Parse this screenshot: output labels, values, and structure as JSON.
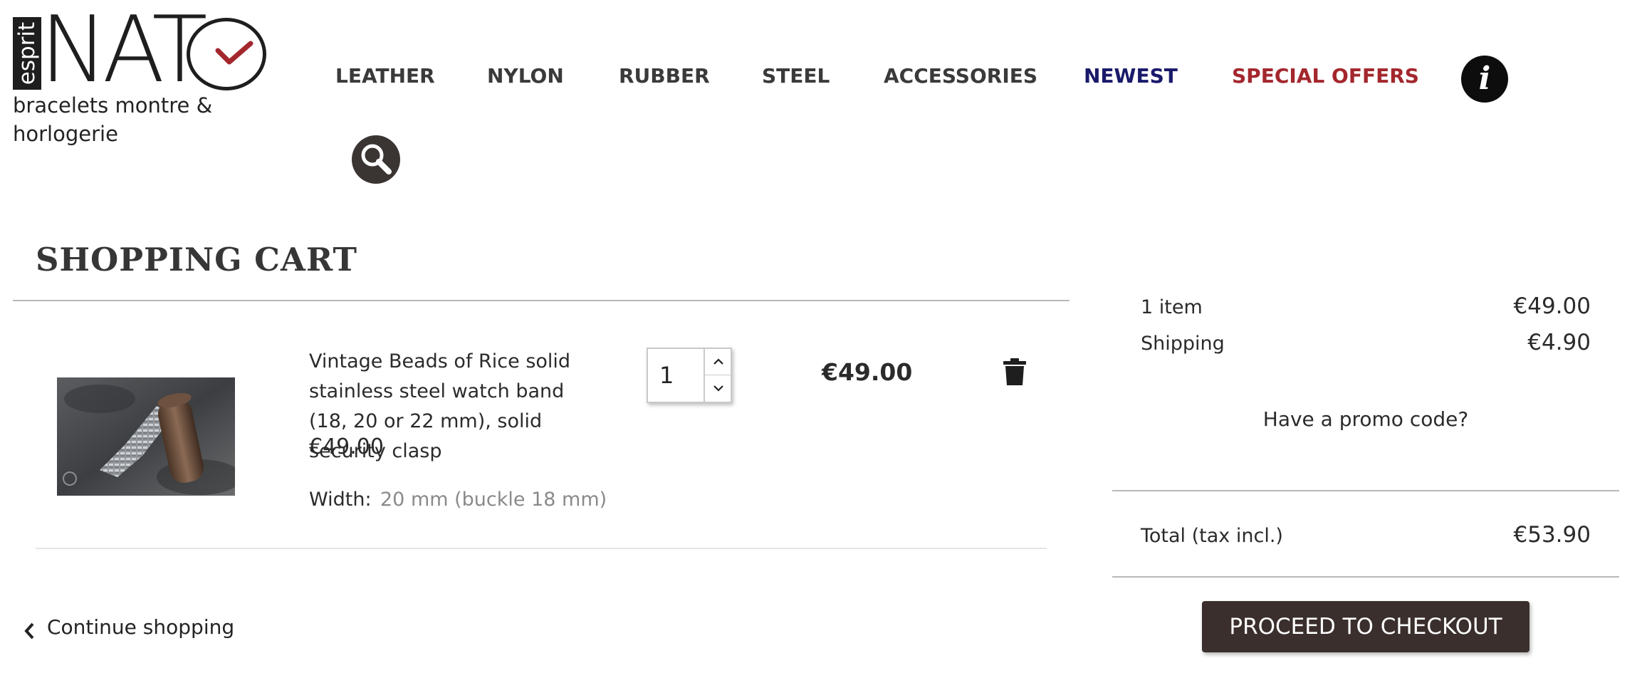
{
  "brand": {
    "logo_side_text": "esprit",
    "logo_word": "NAT",
    "tagline_line1": "bracelets montre &",
    "tagline_line2": "horlogerie"
  },
  "nav": {
    "items": [
      {
        "label": "LEATHER"
      },
      {
        "label": "NYLON"
      },
      {
        "label": "RUBBER"
      },
      {
        "label": "STEEL"
      },
      {
        "label": "ACCESSORIES"
      },
      {
        "label": "NEWEST"
      },
      {
        "label": "SPECIAL OFFERS"
      }
    ],
    "info_icon_glyph": "i",
    "colors": {
      "default": "#3a3a3a",
      "newest": "#1a1a6b",
      "special": "#a3272d"
    }
  },
  "cart": {
    "title": "SHOPPING CART",
    "items": [
      {
        "name": "Vintage Beads of Rice solid stainless steel watch band (18, 20 or 22 mm), solid security clasp",
        "unit_price": "€49.00",
        "attribute_label": "Width:",
        "attribute_value": "20 mm (buckle 18 mm)",
        "quantity": "1",
        "line_total": "€49.00"
      }
    ],
    "continue_label": "Continue shopping"
  },
  "summary": {
    "items_label": "1 item",
    "items_value": "€49.00",
    "shipping_label": "Shipping",
    "shipping_value": "€4.90",
    "promo_label": "Have a promo code?",
    "total_label": "Total (tax incl.)",
    "total_value": "€53.90",
    "checkout_label": "PROCEED TO CHECKOUT"
  },
  "icons": {
    "info": "info-icon",
    "search": "search-icon",
    "trash": "trash-icon",
    "chevron_left": "chevron-left-icon",
    "chevron_up": "chevron-up-icon",
    "chevron_down": "chevron-down-icon"
  },
  "colors": {
    "checkout_bg": "#3a2f2c",
    "logo_check": "#a3272d"
  }
}
